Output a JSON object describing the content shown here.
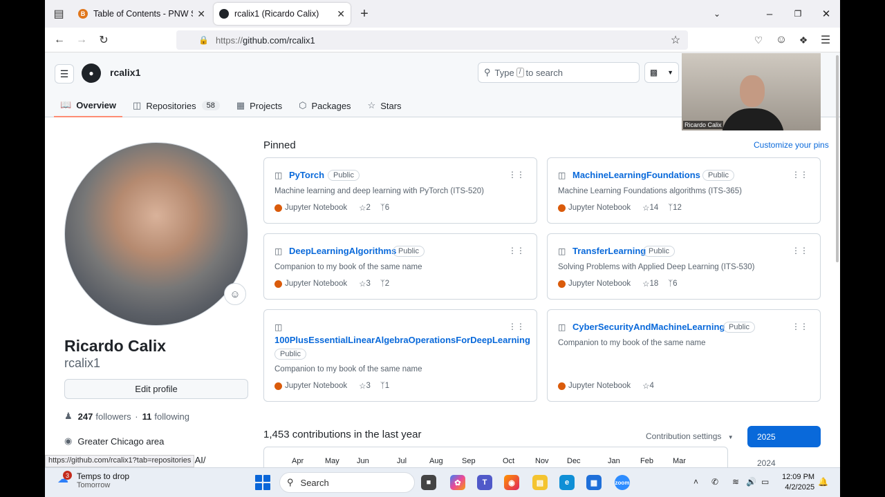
{
  "browser": {
    "tabs": [
      {
        "title": "Table of Contents - PNW Spring",
        "favicon": "B"
      },
      {
        "title": "rcalix1 (Ricardo Calix)",
        "favicon": "github"
      }
    ],
    "url_scheme": "https://",
    "url_host": "github.com/rcalix1",
    "status_url": "https://github.com/rcalix1?tab=repositories"
  },
  "github": {
    "username": "rcalix1",
    "search": {
      "prefix": "Type",
      "key": "/",
      "suffix": "to search"
    },
    "tabs": [
      {
        "label": "Overview",
        "icon": "book-icon"
      },
      {
        "label": "Repositories",
        "icon": "repo-icon",
        "count": "58"
      },
      {
        "label": "Projects",
        "icon": "table-icon"
      },
      {
        "label": "Packages",
        "icon": "package-icon"
      },
      {
        "label": "Stars",
        "icon": "star-icon"
      }
    ]
  },
  "video": {
    "name": "Ricardo Calix"
  },
  "profile": {
    "full_name": "Ricardo Calix",
    "login": "rcalix1",
    "edit_label": "Edit profile",
    "followers": "247",
    "followers_label": "followers",
    "following": "11",
    "following_label": "following",
    "location": "Greater Chicago area",
    "truncated": ":AI/"
  },
  "pinned": {
    "heading": "Pinned",
    "customize": "Customize your pins",
    "repos": [
      {
        "name": "PyTorch",
        "visibility": "Public",
        "desc": "Machine learning and deep learning with PyTorch (ITS-520)",
        "lang": "Jupyter Notebook",
        "stars": "2",
        "forks": "6"
      },
      {
        "name": "MachineLearningFoundations",
        "visibility": "Public",
        "desc": "Machine Learning Foundations algorithms (ITS-365)",
        "lang": "Jupyter Notebook",
        "stars": "14",
        "forks": "12"
      },
      {
        "name": "DeepLearningAlgorithms",
        "visibility": "Public",
        "desc": "Companion to my book of the same name",
        "lang": "Jupyter Notebook",
        "stars": "3",
        "forks": "2"
      },
      {
        "name": "TransferLearning",
        "visibility": "Public",
        "desc": "Solving Problems with Applied Deep Learning (ITS-530)",
        "lang": "Jupyter Notebook",
        "stars": "18",
        "forks": "6"
      },
      {
        "name": "100PlusEssentialLinearAlgebraOperationsForDeepLearning",
        "visibility": "Public",
        "desc": "Companion to my book of the same name",
        "lang": "Jupyter Notebook",
        "stars": "3",
        "forks": "1"
      },
      {
        "name": "CyberSecurityAndMachineLearning",
        "visibility": "Public",
        "desc": "Companion to my book of the same name",
        "lang": "Jupyter Notebook",
        "stars": "4"
      }
    ]
  },
  "contributions": {
    "heading": "1,453 contributions in the last year",
    "settings": "Contribution settings",
    "months": [
      "Apr",
      "May",
      "Jun",
      "Jul",
      "Aug",
      "Sep",
      "Oct",
      "Nov",
      "Dec",
      "Jan",
      "Feb",
      "Mar"
    ],
    "years": [
      "2025",
      "2024"
    ]
  },
  "taskbar": {
    "weather_title": "Temps to drop",
    "weather_sub": "Tomorrow",
    "badge": "3",
    "search": "Search",
    "time": "12:09 PM",
    "date": "4/2/2025"
  },
  "colors": {
    "accent": "#0969da",
    "jupyter": "#DA5B0B",
    "tab_underline": "#fd8c73"
  }
}
